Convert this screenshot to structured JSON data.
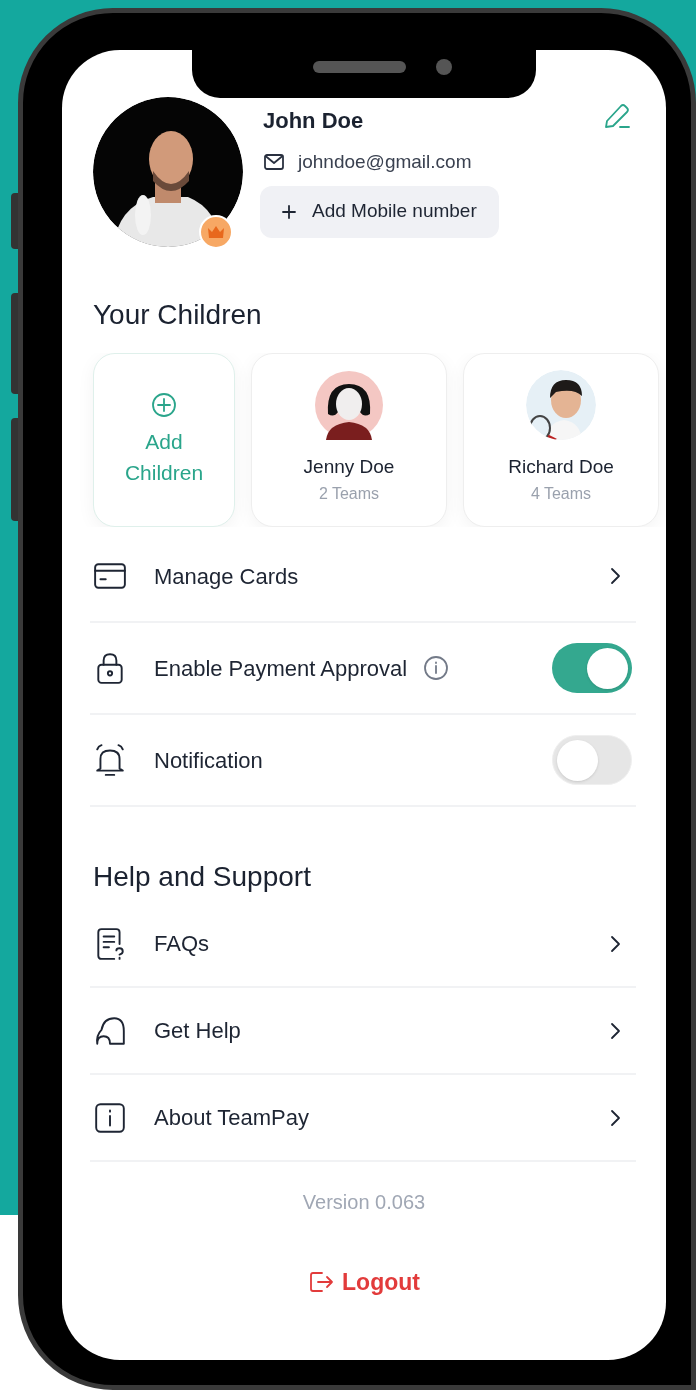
{
  "profile": {
    "name": "John Doe",
    "email": "johndoe@gmail.com",
    "add_mobile": "Add Mobile number"
  },
  "children_section": {
    "title": "Your Children",
    "add_label": "Add Children",
    "children": [
      {
        "name": "Jenny Doe",
        "teams": "2 Teams",
        "kind": "avatar"
      },
      {
        "name": "Richard Doe",
        "teams": "4 Teams",
        "kind": "picture"
      }
    ]
  },
  "settings": [
    {
      "label": "Manage Cards",
      "kind": "link"
    },
    {
      "label": "Enable Payment Approval",
      "kind": "toggle",
      "info": true,
      "on": true
    },
    {
      "label": "Notification",
      "kind": "toggle",
      "info": false,
      "on": false
    }
  ],
  "help_section": {
    "title": "Help and Support",
    "items": [
      {
        "label": "FAQs",
        "kind": "link"
      },
      {
        "label": "Get Help",
        "kind": "link"
      },
      {
        "label": "About TeamPay",
        "kind": "link"
      }
    ]
  },
  "version": "Version 0.063",
  "logout": "Logout"
}
